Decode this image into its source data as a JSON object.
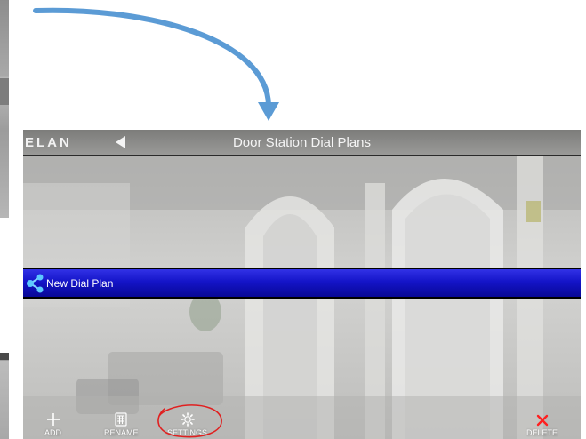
{
  "app": {
    "logo_text": "ELAN",
    "title": "Door Station Dial Plans"
  },
  "list": {
    "items": [
      {
        "label": "New Dial Plan"
      }
    ]
  },
  "toolbar": {
    "add_label": "ADD",
    "rename_label": "RENAME",
    "settings_label": "SETTINGS",
    "delete_label": "DELETE"
  },
  "icons": {
    "back": "back-triangle-icon",
    "list_item": "share-icon",
    "add": "plus-icon",
    "rename": "keypad-icon",
    "settings": "gear-icon",
    "delete": "x-icon"
  },
  "colors": {
    "annotation_arrow": "#5b9bd5",
    "annotation_circle": "#e02020",
    "selected_row": "#1414c8",
    "delete_accent": "#ff2020"
  }
}
